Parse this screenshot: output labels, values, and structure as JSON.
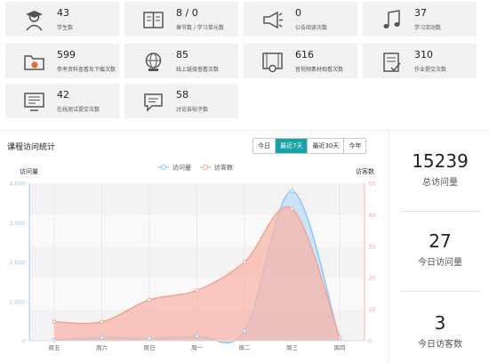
{
  "cards": [
    {
      "num": "43",
      "label": "学生数",
      "icon": "graduate-icon"
    },
    {
      "num": "8 / 0",
      "label": "章节数 / 学习单元数",
      "icon": "book-icon"
    },
    {
      "num": "0",
      "label": "公告阅读次数",
      "icon": "megaphone-icon"
    },
    {
      "num": "37",
      "label": "学习活动数",
      "icon": "music-note-icon"
    },
    {
      "num": "599",
      "label": "参考资料查看及下载次数",
      "icon": "folder-download-icon"
    },
    {
      "num": "85",
      "label": "线上链接查看次数",
      "icon": "globe-icon"
    },
    {
      "num": "616",
      "label": "音视频素材观看次数",
      "icon": "film-icon"
    },
    {
      "num": "310",
      "label": "作业提交次数",
      "icon": "clipboard-check-icon"
    },
    {
      "num": "42",
      "label": "在线测试提交次数",
      "icon": "quiz-screen-icon"
    },
    {
      "num": "58",
      "label": "讨论自帖子数",
      "icon": "chat-bubble-icon"
    }
  ],
  "panel": {
    "title": "课程访问统计",
    "tabs": [
      "今日",
      "最近7天",
      "最近30天",
      "今年"
    ],
    "active_tab": "最近7天"
  },
  "side_stats": [
    {
      "value": "15239",
      "label": "总访问量"
    },
    {
      "value": "27",
      "label": "今日访问量"
    },
    {
      "value": "3",
      "label": "今日访客数"
    }
  ],
  "colors": {
    "accent": "#16a3a6",
    "series_visits": "#9ccbf0",
    "series_visitors": "#f7b8ab"
  },
  "chart_data": {
    "type": "area",
    "categories": [
      "周五",
      "周六",
      "周日",
      "周一",
      "周二",
      "周三",
      "周四"
    ],
    "y_left_label": "访问量",
    "y_right_label": "访客数",
    "y_left_ticks": [
      "0",
      "1,000",
      "2,000",
      "3,000",
      "4,000"
    ],
    "y_right_ticks": [
      "0",
      "10",
      "20",
      "30",
      "40",
      "50"
    ],
    "ylim_left": [
      0,
      4000
    ],
    "ylim_right": [
      0,
      50
    ],
    "series": [
      {
        "name": "访问量",
        "axis": "left",
        "values": [
          20,
          80,
          60,
          120,
          250,
          3800,
          30
        ]
      },
      {
        "name": "访客数",
        "axis": "right",
        "values": [
          6,
          6,
          13,
          16,
          25,
          42,
          1
        ]
      }
    ],
    "legend_position": "top-center"
  }
}
